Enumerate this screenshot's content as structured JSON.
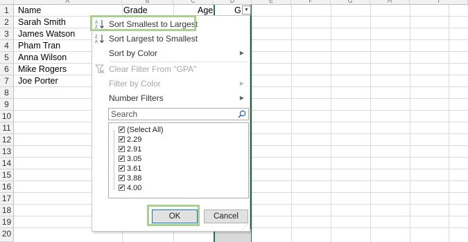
{
  "column_headers": [
    "A",
    "B",
    "C",
    "D",
    "E",
    "F",
    "G",
    "H",
    "I"
  ],
  "row_numbers": [
    "1",
    "2",
    "3",
    "4",
    "5",
    "6",
    "7",
    "8",
    "9",
    "10",
    "11",
    "12",
    "13",
    "14",
    "15",
    "16",
    "17",
    "18",
    "19",
    "20"
  ],
  "cells": {
    "a1": "Name",
    "b1": "Grade",
    "c1": "Age",
    "d1": "G",
    "names": [
      "Sarah Smith",
      "James Watson",
      "Pham Tran",
      "Anna Wilson",
      "Mike Rogers",
      "Joe Porter"
    ]
  },
  "filter_menu": {
    "sort_asc": "Sort Smallest to Largest",
    "sort_desc": "Sort Largest to Smallest",
    "sort_color": "Sort by Color",
    "clear_filter": "Clear Filter From \"GPA\"",
    "filter_color": "Filter by Color",
    "number_filters": "Number Filters",
    "search_placeholder": "Search",
    "values": [
      "(Select All)",
      "2.29",
      "2.91",
      "3.05",
      "3.61",
      "3.88",
      "4.00"
    ],
    "ok": "OK",
    "cancel": "Cancel"
  },
  "colors": {
    "highlight": "#a9d08e",
    "selection": "#217346",
    "accent": "#0078d7"
  }
}
